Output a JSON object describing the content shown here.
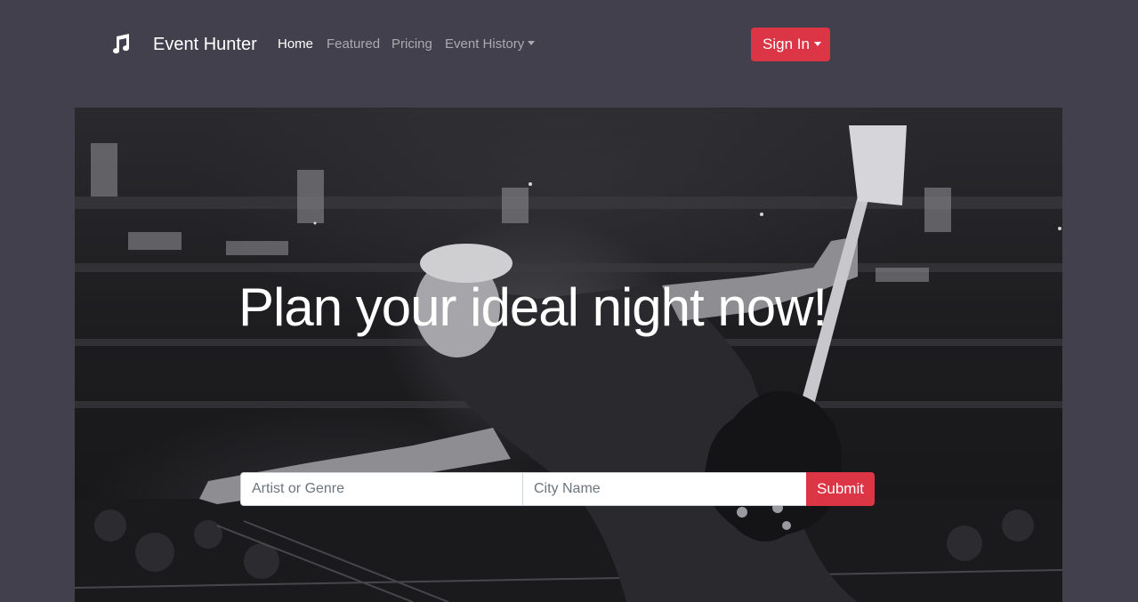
{
  "navbar": {
    "brand": {
      "name": "Event Hunter",
      "icon": "music-note-icon"
    },
    "links": [
      {
        "label": "Home",
        "active": true
      },
      {
        "label": "Featured",
        "active": false
      },
      {
        "label": "Pricing",
        "active": false
      },
      {
        "label": "Event History",
        "active": false,
        "dropdown": true
      }
    ],
    "signin_label": "Sign In"
  },
  "hero": {
    "title": "Plan your ideal night now!",
    "background": "concert-guitarist-photo",
    "search": {
      "artist_placeholder": "Artist or Genre",
      "city_placeholder": "City Name",
      "submit_label": "Submit"
    }
  },
  "colors": {
    "page_bg": "#42404d",
    "accent": "#dc3545",
    "text_light": "#ffffff",
    "nav_muted": "rgba(255,255,255,0.55)"
  }
}
